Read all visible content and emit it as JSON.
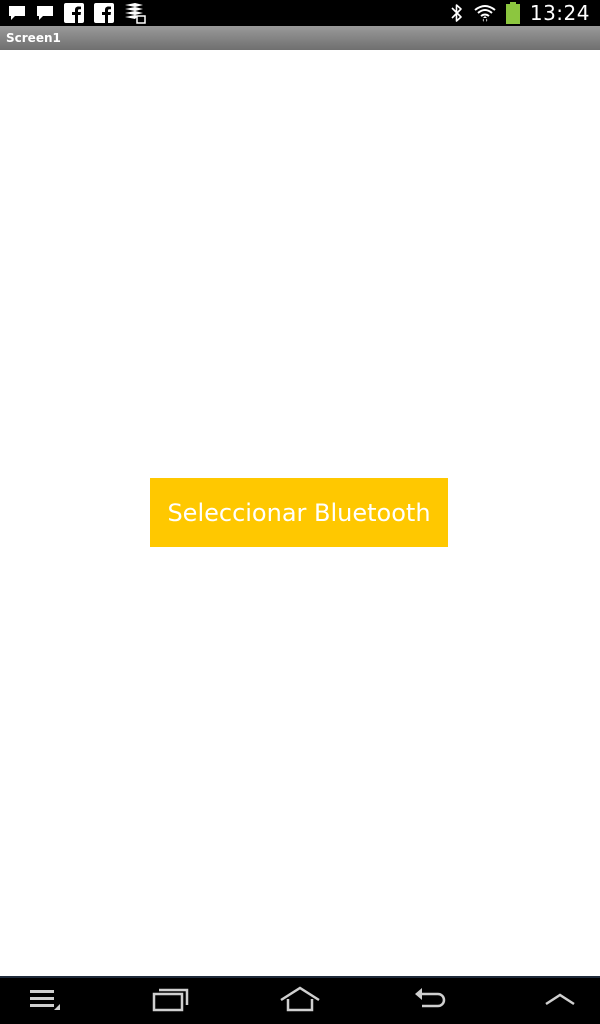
{
  "status_bar": {
    "notification_icons": [
      "chat-icon",
      "chat-icon",
      "facebook-icon",
      "facebook-icon",
      "stack-icon"
    ],
    "system_icons": [
      "bluetooth-icon",
      "wifi-icon",
      "battery-icon"
    ],
    "time": "13:24",
    "battery_color": "#8cc63f"
  },
  "title_bar": {
    "title": "Screen1"
  },
  "main": {
    "button_label": "Seleccionar Bluetooth",
    "button_color": "#ffc800",
    "button_text_color": "#ffffff"
  },
  "nav_bar": {
    "buttons": [
      "menu-icon",
      "recent-apps-icon",
      "home-icon",
      "back-icon",
      "chevron-up-icon"
    ]
  }
}
